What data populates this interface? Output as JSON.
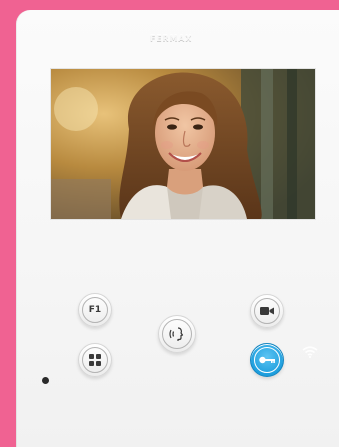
{
  "device": {
    "brand_label": "FERMAX",
    "accent_color": "#f06292",
    "screen": {
      "content": "video-call-feed"
    },
    "buttons": {
      "f1": {
        "label": "F1",
        "icon": "f1-icon"
      },
      "menu": {
        "icon": "grid-menu-icon"
      },
      "talk": {
        "icon": "talk-icon"
      },
      "camera": {
        "icon": "camera-icon"
      },
      "door": {
        "icon": "key-icon",
        "color": "#1e9fde"
      }
    },
    "status": {
      "icon": "wifi-icon"
    }
  }
}
